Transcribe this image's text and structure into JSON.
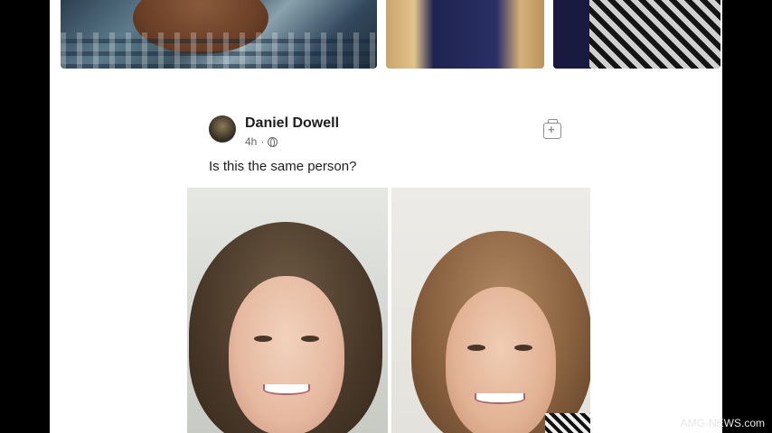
{
  "post": {
    "author": "Daniel Dowell",
    "time": "4h",
    "separator": "·",
    "caption": "Is this the same person?"
  },
  "watermark": "AMG-NEWS.com",
  "icons": {
    "privacy": "globe-icon",
    "save": "save-post-icon"
  }
}
